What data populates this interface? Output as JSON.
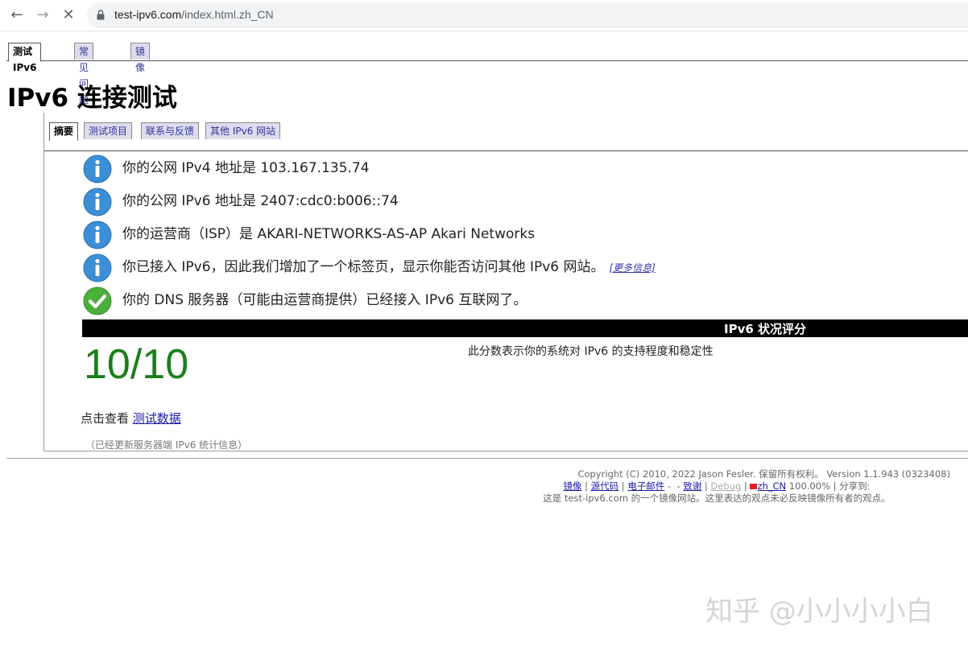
{
  "browser": {
    "url_host": "test-ipv6.com",
    "url_path": "/index.html.zh_CN"
  },
  "top_tabs": [
    "测试 IPv6",
    "常见问题",
    "镜像"
  ],
  "title": "IPv6 连接测试",
  "sub_tabs": [
    "摘要",
    "测试项目",
    "联系与反馈",
    "其他 IPv6 网站"
  ],
  "info": [
    {
      "icon": "info-icon",
      "text": "你的公网 IPv4 地址是 103.167.135.74"
    },
    {
      "icon": "info-icon",
      "text": "你的公网 IPv6 地址是 2407:cdc0:b006::74"
    },
    {
      "icon": "info-icon",
      "text": "你的运营商（ISP）是 AKARI-NETWORKS-AS-AP Akari Networks"
    },
    {
      "icon": "info-icon",
      "text": "你已接入 IPv6，因此我们增加了一个标签页，显示你能否访问其他 IPv6 网站。",
      "link": "[更多信息]"
    },
    {
      "icon": "check-icon",
      "text": "你的 DNS 服务器（可能由运营商提供）已经接入 IPv6 互联网了。"
    }
  ],
  "score": {
    "title": "IPv6 状况评分",
    "value": "10/10",
    "description": "此分数表示你的系统对 IPv6 的支持程度和稳定性"
  },
  "view_data": {
    "prefix": "点击查看",
    "link": "测试数据"
  },
  "stats_note": "（已经更新服务器端 IPv6 统计信息）",
  "footer": {
    "copyright": "Copyright (C) 2010, 2022 Jason Fesler. 保留所有权利。 Version 1.1.943 (0323408)",
    "links": [
      "镜像",
      "源代码",
      "电子邮件",
      "致谢",
      "Debug",
      "zh_CN"
    ],
    "zoom": "100.00%",
    "share": "分享到:",
    "mirror_note": "这是 test-ipv6.com 的一个镜像网站。这里表达的观点未必反映镜像所有者的观点。"
  },
  "watermark": "知乎 @小小小小白",
  "colors": {
    "score_green": "#1a7f1a",
    "info_blue": "#3b8fd6",
    "check_green": "#4caf3c"
  }
}
